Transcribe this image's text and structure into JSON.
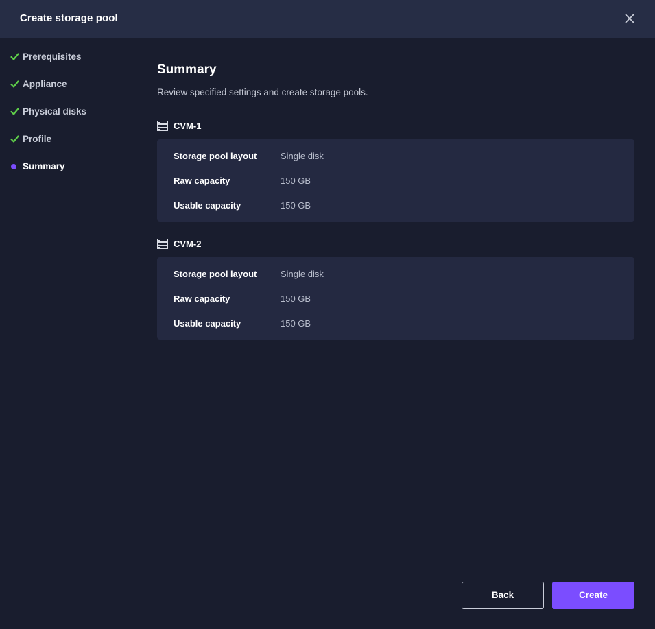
{
  "dialog": {
    "title": "Create storage pool",
    "close_icon": "close-icon"
  },
  "steps": [
    {
      "label": "Prerequisites",
      "state": "done",
      "icon": "check-icon"
    },
    {
      "label": "Appliance",
      "state": "done",
      "icon": "check-icon"
    },
    {
      "label": "Physical disks",
      "state": "done",
      "icon": "check-icon"
    },
    {
      "label": "Profile",
      "state": "done",
      "icon": "check-icon"
    },
    {
      "label": "Summary",
      "state": "current",
      "icon": "dot-icon"
    }
  ],
  "summary": {
    "title": "Summary",
    "description": "Review specified settings and create storage pools.",
    "pools": [
      {
        "name": "CVM-1",
        "icon": "server-icon",
        "rows": [
          {
            "key": "Storage pool layout",
            "value": "Single disk"
          },
          {
            "key": "Raw capacity",
            "value": "150 GB"
          },
          {
            "key": "Usable capacity",
            "value": "150 GB"
          }
        ]
      },
      {
        "name": "CVM-2",
        "icon": "server-icon",
        "rows": [
          {
            "key": "Storage pool layout",
            "value": "Single disk"
          },
          {
            "key": "Raw capacity",
            "value": "150 GB"
          },
          {
            "key": "Usable capacity",
            "value": "150 GB"
          }
        ]
      }
    ]
  },
  "footer": {
    "back_label": "Back",
    "create_label": "Create"
  },
  "colors": {
    "background": "#191d2e",
    "header": "#262d45",
    "card": "#242941",
    "accent": "#7b4dff",
    "check": "#5fcf4a"
  }
}
